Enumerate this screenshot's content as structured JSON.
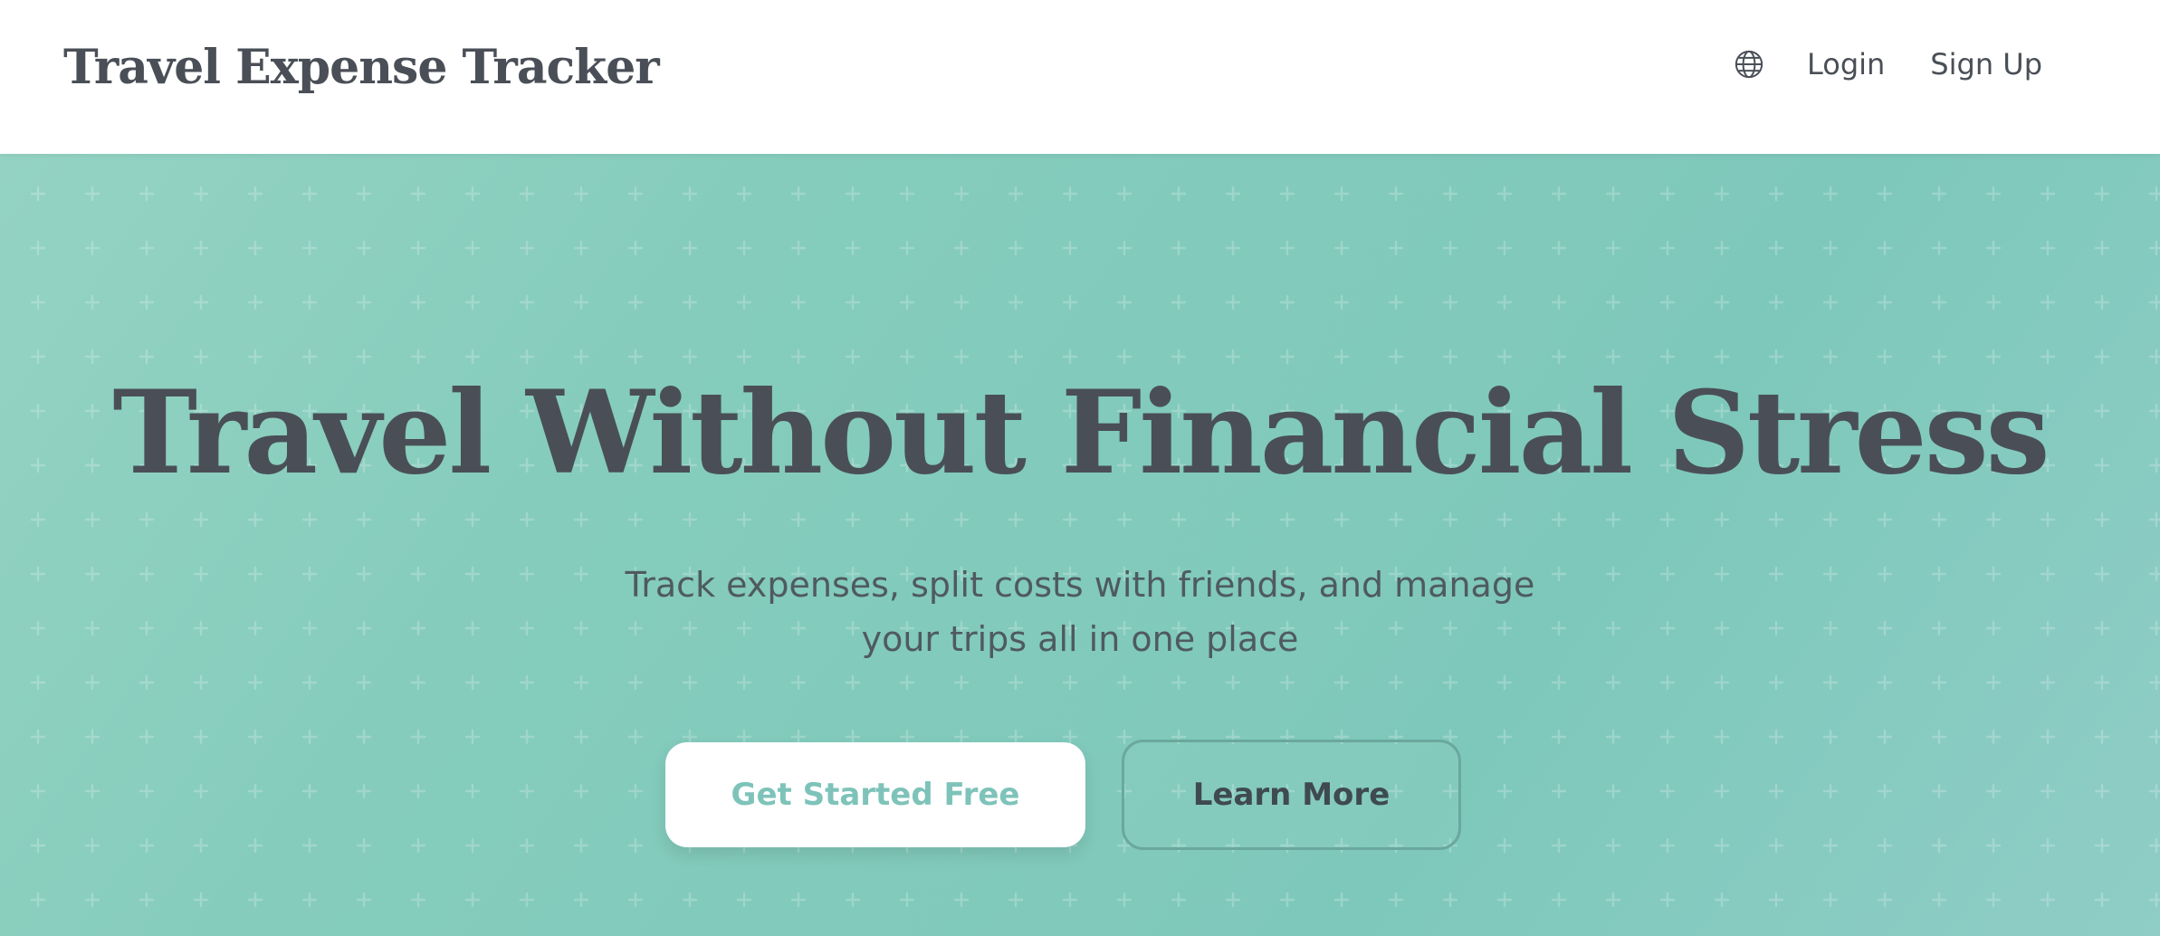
{
  "brand": {
    "title": "Travel Expense Tracker"
  },
  "nav": {
    "language_icon": "globe-icon",
    "login_label": "Login",
    "signup_label": "Sign Up"
  },
  "hero": {
    "headline": "Travel Without Financial Stress",
    "subtitle_line1": "Track expenses, split costs with friends, and manage",
    "subtitle_line2": "your trips all in one place",
    "primary_cta": "Get Started Free",
    "secondary_cta": "Learn More"
  },
  "colors": {
    "text_dark": "#4a4f57",
    "hero_teal": "#85ccbc",
    "primary_cta_text": "#7ec3b9",
    "nav_background": "#ffffff"
  }
}
